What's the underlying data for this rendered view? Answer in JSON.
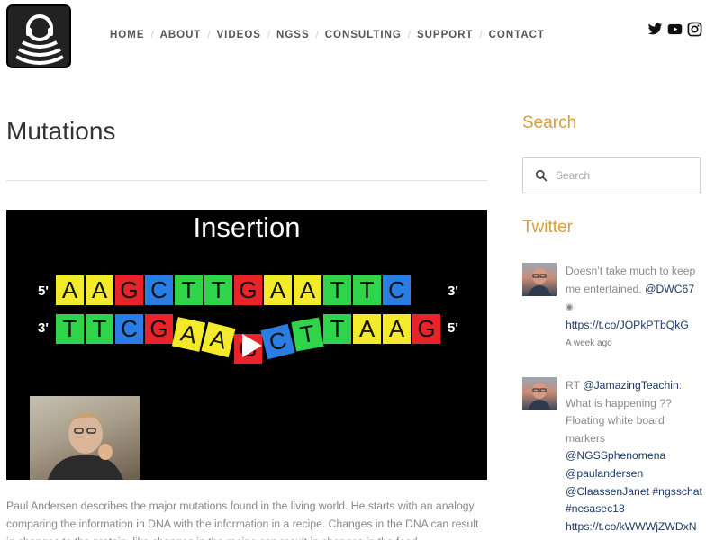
{
  "nav": {
    "items": [
      {
        "label": "HOME"
      },
      {
        "label": "ABOUT"
      },
      {
        "label": "VIDEOS"
      },
      {
        "label": "NGSS"
      },
      {
        "label": "CONSULTING"
      },
      {
        "label": "SUPPORT"
      },
      {
        "label": "CONTACT"
      }
    ]
  },
  "social": [
    "twitter-icon",
    "youtube-icon",
    "instagram-icon"
  ],
  "page": {
    "title": "Mutations",
    "description": "Paul Andersen describes the major mutations found in the living world. He starts with an analogy comparing the information in DNA with the information in a recipe. Changes in the DNA can result in changes to the protein, like changes in the recipe can result in changes in the food."
  },
  "video": {
    "heading": "Insertion",
    "top_strand": [
      "A",
      "A",
      "G",
      "C",
      "T",
      "T",
      "G",
      "A",
      "A",
      "T",
      "T",
      "C"
    ],
    "bottom_strand": [
      "T",
      "T",
      "C",
      "G",
      "A",
      "A",
      "G",
      "C",
      "T",
      "T",
      "A",
      "A",
      "G"
    ],
    "labels": {
      "top_left": "5'",
      "top_right": "3'",
      "bottom_left": "3'",
      "bottom_right": "5'"
    },
    "colors": {
      "A": "#f2ea2a",
      "G": "#e8232a",
      "C": "#2a7ee3",
      "T": "#2fd44a"
    }
  },
  "sidebar": {
    "search_heading": "Search",
    "search_placeholder": "Search",
    "twitter_heading": "Twitter",
    "tweets": [
      {
        "pre": "Doesn’t take much to keep me entertained. ",
        "handle": "@DWC67",
        "link": "https://t.co/JOPkPTbQkG",
        "time": "A week ago"
      },
      {
        "rt": "RT ",
        "handle1": "@JamazingTeachin",
        "text": ": What is happening ?? Floating white board markers ",
        "tags": [
          "@NGSSphenomena",
          "@paulandersen",
          "@ClaassenJanet",
          "#ngsschat",
          "#nesasec18"
        ],
        "link": "https://t.co/kWWWjZWDxN"
      }
    ]
  }
}
